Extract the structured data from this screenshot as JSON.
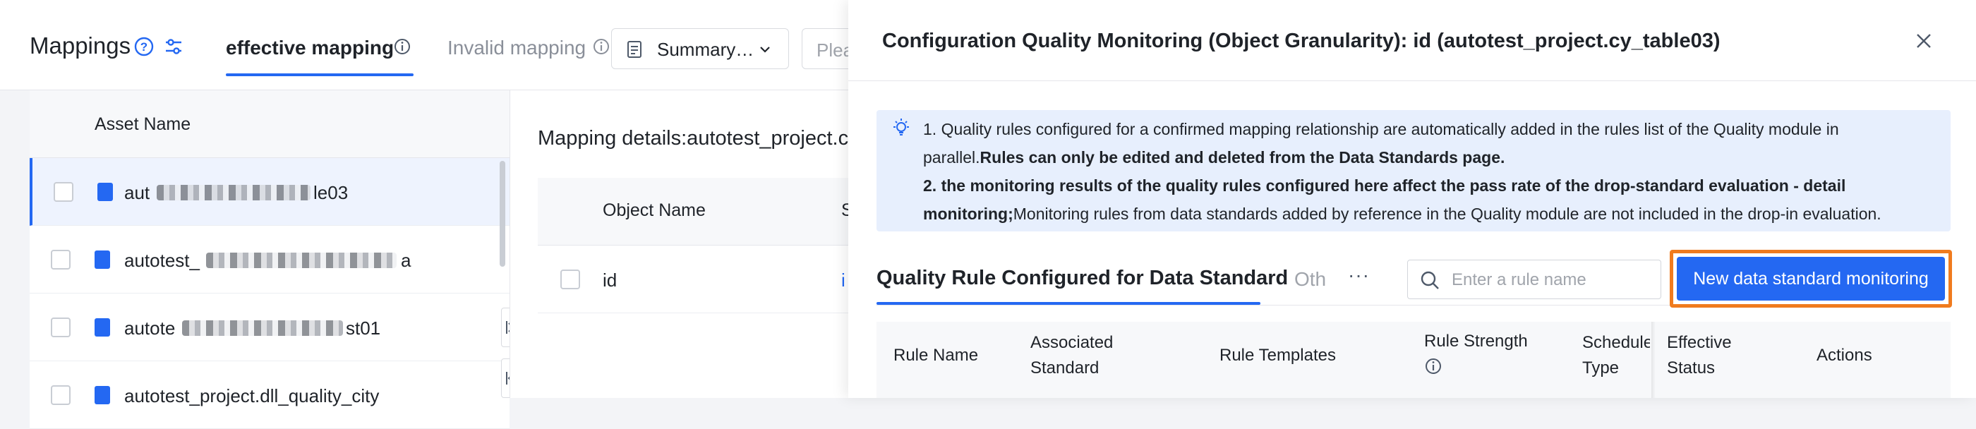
{
  "page": {
    "title": "Mappings",
    "tabs": [
      {
        "label": "effective mapping"
      },
      {
        "label": "Invalid mapping"
      }
    ],
    "summary_select": "Summary…",
    "search_partial": "Plea"
  },
  "asset_table": {
    "header": "Asset Name",
    "rows": [
      {
        "name_prefix": "aut",
        "name_suffix": "le03"
      },
      {
        "name_prefix": "autotest_",
        "name_suffix": "a"
      },
      {
        "name_prefix": "autote",
        "name_suffix": "st01"
      },
      {
        "name": "autotest_project.dll_quality_city"
      }
    ]
  },
  "mapping_panel": {
    "title": "Mapping details:autotest_project.cy",
    "column": "Object Name",
    "column_cut": "S",
    "row_value": "id",
    "row_cut": "i"
  },
  "drawer": {
    "title": "Configuration Quality Monitoring (Object Granularity): id (autotest_project.cy_table03)",
    "notice": {
      "line1": "1. Quality rules configured for a confirmed mapping relationship are automatically added in the rules list of the Quality module in",
      "line2_normal": "parallel.",
      "line2_bold": "Rules can only be edited and deleted from the Data Standards page.",
      "line3_bold": "2. the monitoring results of the quality rules configured here affect the pass rate of the drop-standard evaluation - detail",
      "line4_bold": "monitoring;",
      "line4_normal": "Monitoring rules from data standards added by reference in the Quality module are not included in the drop-in evaluation."
    },
    "tabs": {
      "active": "Quality Rule Configured for Data Standard",
      "other": "Oth",
      "more": "···"
    },
    "search": {
      "placeholder": "Enter a rule name",
      "value": ""
    },
    "new_button": "New data standard monitoring",
    "columns": {
      "rule_name": "Rule Name",
      "associated_standard_1": "Associated",
      "associated_standard_2": "Standard",
      "rule_templates": "Rule Templates",
      "rule_strength": "Rule Strength",
      "schedule_1": "Schedule",
      "schedule_2": "Type",
      "effective_1": "Effective",
      "effective_2": "Status",
      "actions": "Actions"
    }
  },
  "colors": {
    "accent": "#2468f2",
    "highlight": "#f07b1e",
    "notice_bg": "#e7effd"
  }
}
